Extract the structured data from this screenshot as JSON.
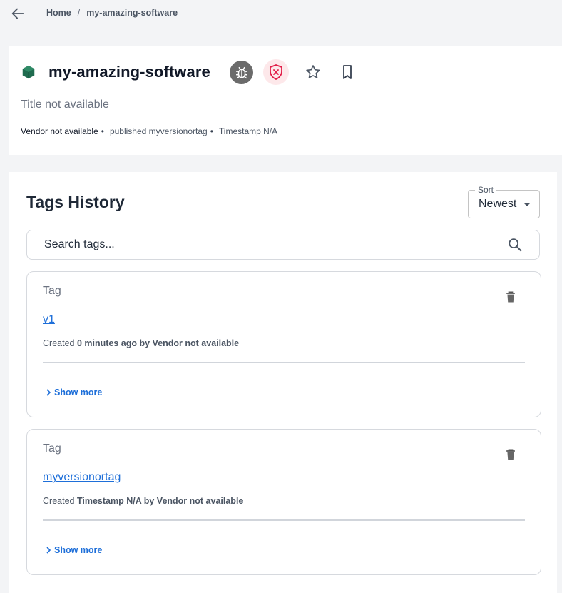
{
  "breadcrumb": {
    "home": "Home",
    "separator": "/",
    "current": "my-amazing-software"
  },
  "package": {
    "name": "my-amazing-software",
    "title": "Title not available",
    "vendor": "Vendor not available",
    "bullet": "•",
    "published": "published myversionortag",
    "timestamp": "Timestamp N/A"
  },
  "colors": {
    "brand_green": "#1f6b4f",
    "link_blue": "#1e6fd9",
    "danger_red": "#e11d48"
  },
  "icons": [
    "back-arrow-icon",
    "package-cube-icon",
    "bug-icon",
    "shield-x-icon",
    "star-icon",
    "bookmark-icon",
    "search-icon",
    "trash-icon",
    "chevron-right-icon"
  ],
  "history": {
    "title": "Tags History",
    "sort": {
      "label": "Sort",
      "value": "Newest"
    },
    "search": {
      "placeholder": "Search tags..."
    },
    "tags": [
      {
        "label": "Tag",
        "name": "v1",
        "created_prefix": "Created",
        "created_when": "0 minutes ago by Vendor not available",
        "show_more": "Show more"
      },
      {
        "label": "Tag",
        "name": "myversionortag",
        "created_prefix": "Created",
        "created_when": "Timestamp N/A by Vendor not available",
        "show_more": "Show more"
      }
    ]
  }
}
